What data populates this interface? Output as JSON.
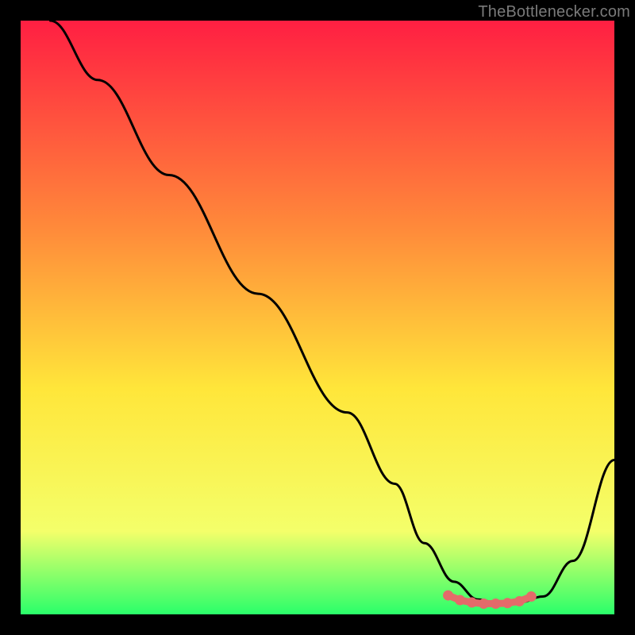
{
  "watermark": "TheBottlenecker.com",
  "colors": {
    "top": "#ff1f42",
    "mid_upper": "#ff8a3a",
    "mid": "#ffe63a",
    "mid_lower": "#f4ff6a",
    "bottom": "#2aff6a",
    "curve": "#000000",
    "marker": "#e46a6a"
  },
  "chart_data": {
    "type": "line",
    "title": "",
    "xlabel": "",
    "ylabel": "",
    "xlim": [
      0,
      100
    ],
    "ylim": [
      0,
      100
    ],
    "series": [
      {
        "name": "curve",
        "x": [
          5,
          13,
          25,
          40,
          55,
          63,
          68,
          73,
          77,
          80,
          84,
          88,
          93,
          100
        ],
        "y": [
          100,
          90,
          74,
          54,
          34,
          22,
          12,
          5.5,
          2.5,
          2,
          2,
          3,
          9,
          26
        ]
      }
    ],
    "markers": {
      "name": "flat-minimum-highlight",
      "x": [
        72,
        74,
        76,
        78,
        80,
        82,
        84,
        86
      ],
      "y": [
        3.2,
        2.4,
        2.0,
        1.8,
        1.8,
        1.9,
        2.2,
        3.0
      ]
    }
  }
}
